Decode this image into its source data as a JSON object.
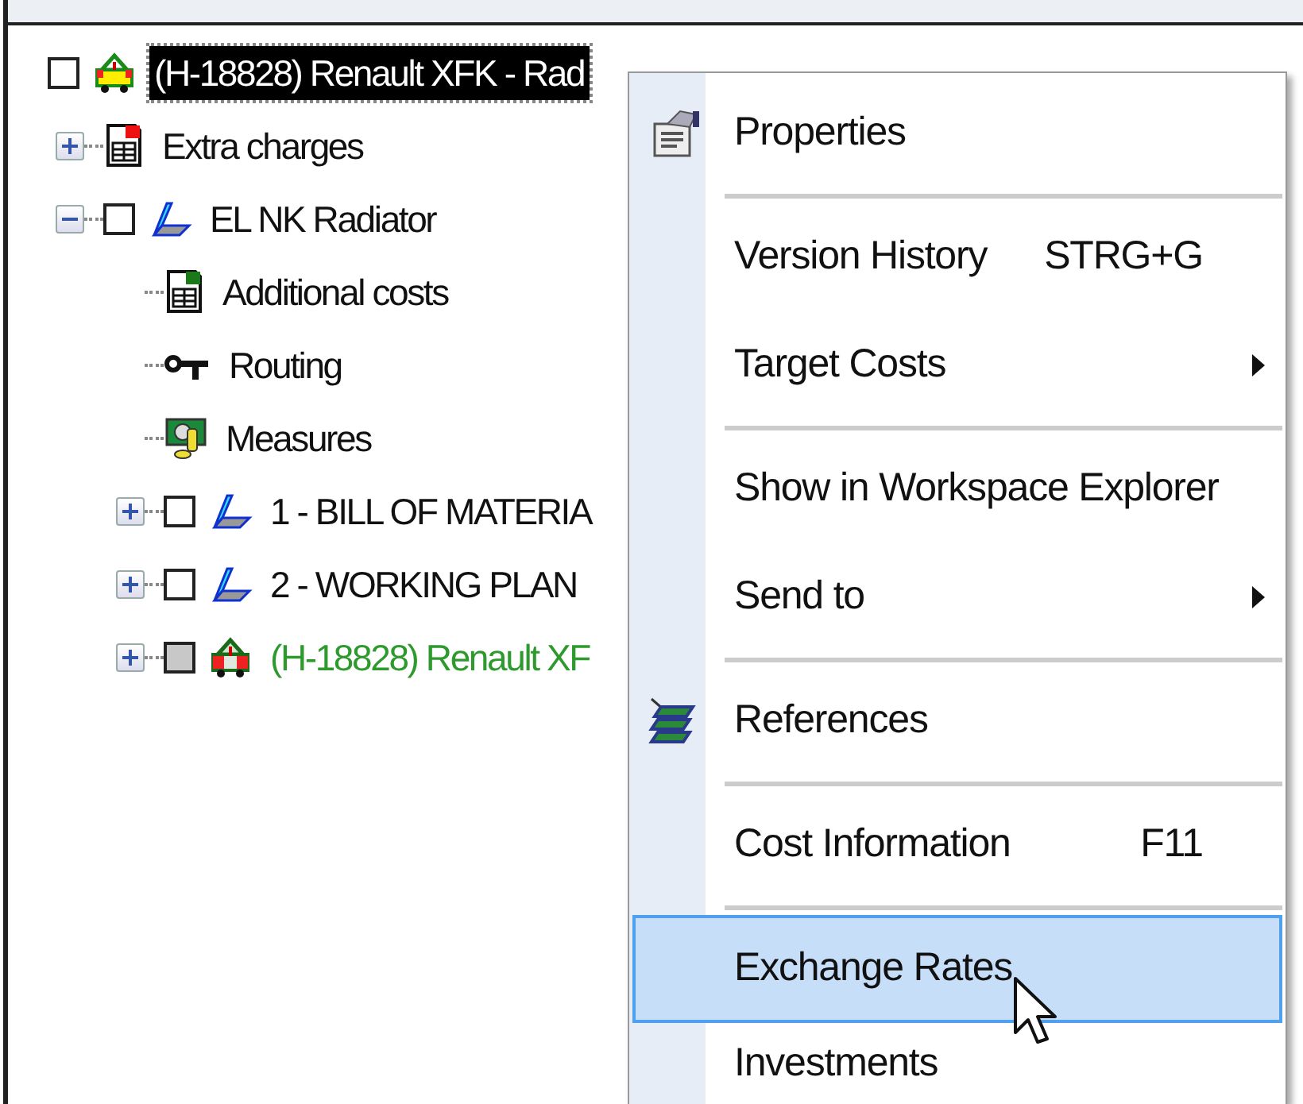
{
  "tree": [
    {
      "label": "(H-18828) Renault XFK - Rad",
      "kind": "vehicle",
      "checked": false,
      "selected": true,
      "children": [
        {
          "label": "Extra charges",
          "kind": "sheet",
          "selected": false,
          "expanded": false
        },
        {
          "label": "EL NK Radiator",
          "kind": "part",
          "checked": false,
          "selected": false,
          "expanded": true,
          "children": [
            {
              "label": "Additional costs",
              "kind": "sheet-green",
              "selected": false
            },
            {
              "label": "Routing",
              "kind": "key",
              "selected": false
            },
            {
              "label": "Measures",
              "kind": "money",
              "selected": false
            },
            {
              "label": "1 - BILL OF MATERIA",
              "kind": "part",
              "checked": false,
              "selected": false,
              "expanded": false
            },
            {
              "label": "2 - WORKING PLAN",
              "kind": "part",
              "checked": false,
              "selected": false,
              "expanded": false
            },
            {
              "label": "(H-18828) Renault XF",
              "kind": "vehicle-red",
              "checked": false,
              "greyed": true,
              "color": "#2e9a2e",
              "selected": false,
              "expanded": false
            }
          ]
        }
      ]
    }
  ],
  "context_menu": [
    {
      "kind": "properties",
      "label": "Properties",
      "selected": false
    },
    {
      "kind": "separator"
    },
    {
      "kind": "item",
      "label": "Version History",
      "shortcut": "STRG+G",
      "selected": false
    },
    {
      "kind": "item",
      "label": "Target Costs",
      "submenu": true,
      "selected": false
    },
    {
      "kind": "separator"
    },
    {
      "kind": "item",
      "label": "Show in Workspace Explorer",
      "selected": false
    },
    {
      "kind": "item",
      "label": "Send to",
      "submenu": true,
      "selected": false
    },
    {
      "kind": "separator"
    },
    {
      "kind": "references",
      "label": "References",
      "selected": false
    },
    {
      "kind": "separator"
    },
    {
      "kind": "item",
      "label": "Cost Information",
      "shortcut": "F11",
      "selected": false
    },
    {
      "kind": "separator"
    },
    {
      "kind": "item",
      "label": "Exchange Rates",
      "selected": true
    },
    {
      "kind": "item",
      "label": "Investments",
      "selected": false
    }
  ]
}
